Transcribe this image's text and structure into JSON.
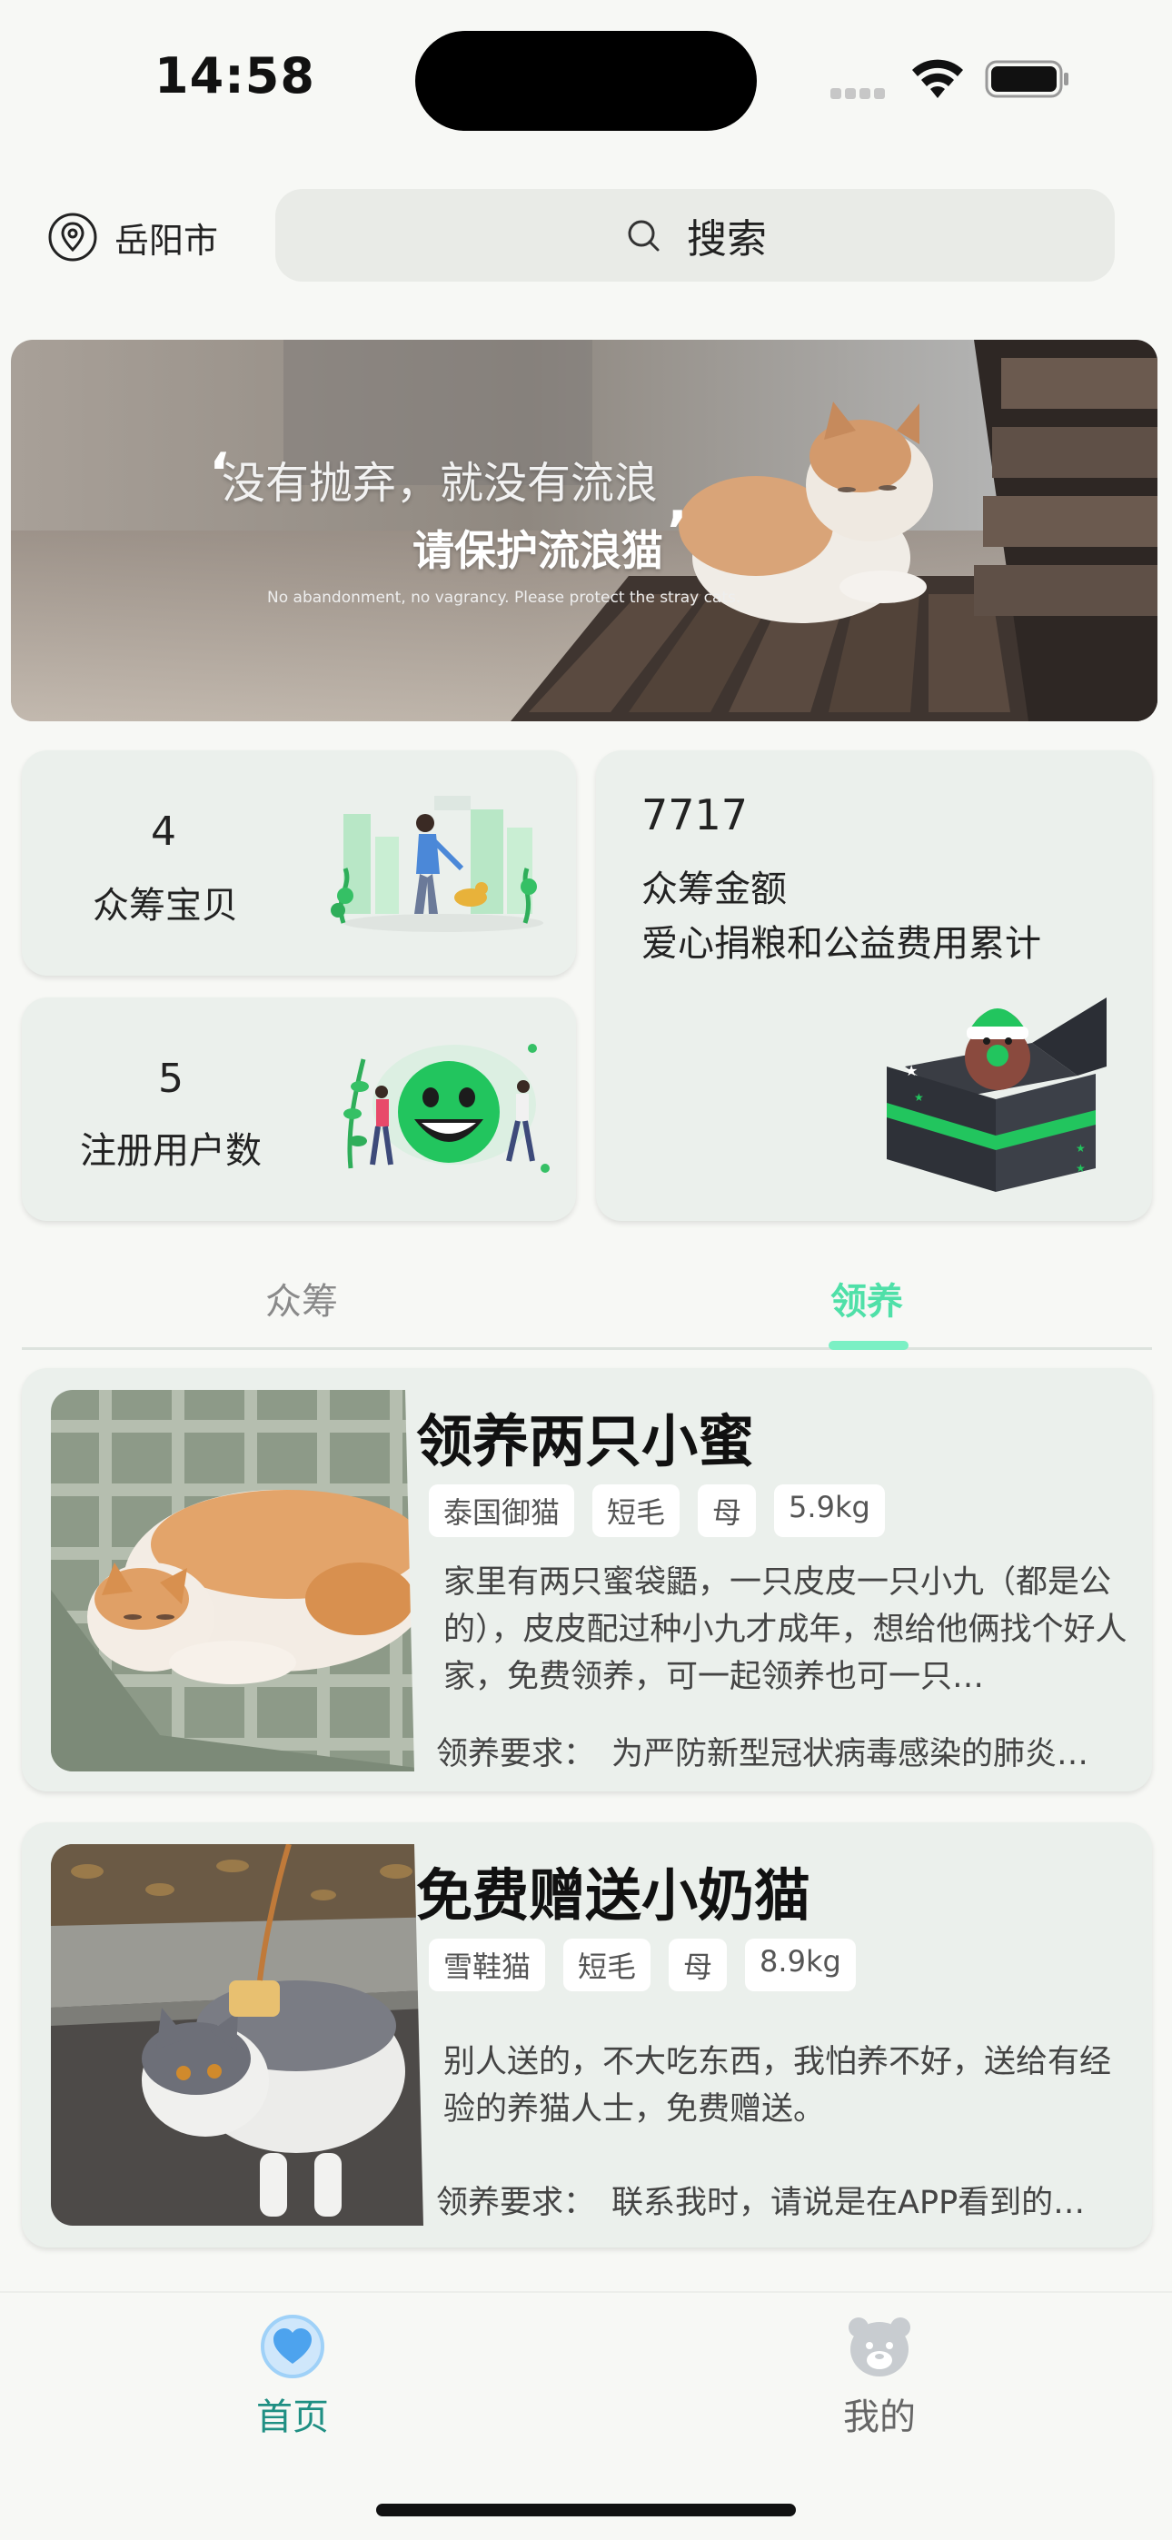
{
  "status_bar": {
    "time": "14:58"
  },
  "header": {
    "city": "岳阳市",
    "search_placeholder": "搜索"
  },
  "banner": {
    "line1": "没有抛弃，就没有流浪",
    "line2": "请保护流浪猫",
    "line3": "No abandonment, no vagrancy. Please protect the stray cats."
  },
  "stats": {
    "babies": {
      "value": "4",
      "label": "众筹宝贝"
    },
    "users": {
      "value": "5",
      "label": "注册用户数"
    },
    "amount": {
      "value": "7717",
      "label": "众筹金额",
      "sub": "爱心捐粮和公益费用累计"
    }
  },
  "tabs": [
    {
      "label": "众筹",
      "active": false
    },
    {
      "label": "领养",
      "active": true
    }
  ],
  "adoptions": [
    {
      "title": "领养两只小蜜",
      "tags": [
        "泰国御猫",
        "短毛",
        "母",
        "5.9kg"
      ],
      "description": "家里有两只蜜袋鼯，一只皮皮一只小九（都是公的），皮皮配过种小九才成年，想给他俩找个好人家，免费领养，可一起领养也可一只…",
      "req_label": "领养要求：",
      "requirement": "为严防新型冠状病毒感染的肺炎…"
    },
    {
      "title": "免费赠送小奶猫",
      "tags": [
        "雪鞋猫",
        "短毛",
        "母",
        "8.9kg"
      ],
      "description": "别人送的，不大吃东西，我怕养不好，送给有经验的养猫人士，免费赠送。",
      "req_label": "领养要求：",
      "requirement": "联系我时，请说是在APP看到的…"
    }
  ],
  "bottom_nav": [
    {
      "label": "首页",
      "icon": "heart-icon",
      "active": true
    },
    {
      "label": "我的",
      "icon": "bear-icon",
      "active": false
    }
  ],
  "colors": {
    "accent": "#4fe0a8",
    "nav_active": "#1f8f83",
    "card_bg": "#ebf0ec",
    "page_bg": "#f7f8f5"
  }
}
